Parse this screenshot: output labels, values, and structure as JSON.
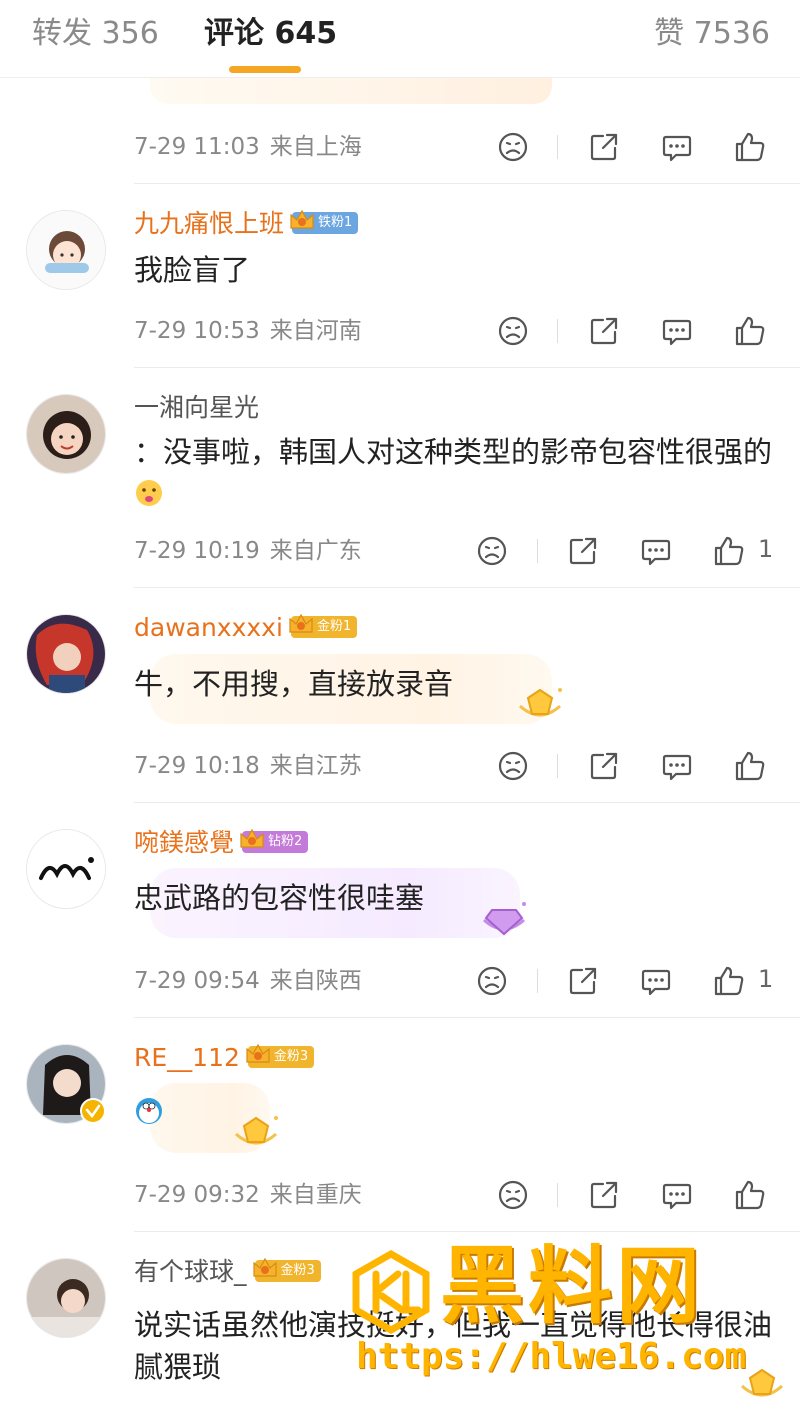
{
  "tabs": {
    "repost": "转发 356",
    "comment": "评论 645",
    "like": "赞 7536"
  },
  "colors": {
    "accent": "#f5a623",
    "username_fan": "#e8711b",
    "meta": "#888888"
  },
  "icons": {
    "dislike": "sad-face-icon",
    "share": "share-icon",
    "reply": "comment-icon",
    "like": "thumb-up-icon"
  },
  "comments": [
    {
      "meta_time": "7-29 11:03",
      "meta_loc": "来自上海",
      "likes": ""
    },
    {
      "username": "九九痛恨上班",
      "badge": "铁粉1",
      "text": "我脸盲了",
      "meta_time": "7-29 10:53",
      "meta_loc": "来自河南",
      "likes": ""
    },
    {
      "username": "一湘向星光",
      "text": "：没事啦，韩国人对这种类型的影帝包容性很强的",
      "emoji": "thinking-face-emoji",
      "meta_time": "7-29 10:19",
      "meta_loc": "来自广东",
      "likes": "1"
    },
    {
      "username": "dawanxxxxi",
      "badge": "金粉1",
      "text": "牛，不用搜，直接放录音",
      "meta_time": "7-29 10:18",
      "meta_loc": "来自江苏",
      "likes": ""
    },
    {
      "username": "啘鎂感覺",
      "badge": "钻粉2",
      "text": "忠武路的包容性很哇塞",
      "meta_time": "7-29 09:54",
      "meta_loc": "来自陕西",
      "likes": "1"
    },
    {
      "username": "RE__112",
      "badge": "金粉3",
      "emoji": "doraemon-emoji",
      "meta_time": "7-29 09:32",
      "meta_loc": "来自重庆",
      "likes": ""
    },
    {
      "username": "有个球球_",
      "badge": "金粉3",
      "text": "说实话虽然他演技挺好，但我一直觉得他长得很油腻猥琐"
    }
  ],
  "watermark": {
    "title": "黑料网",
    "url": "https://hlwe16.com"
  }
}
